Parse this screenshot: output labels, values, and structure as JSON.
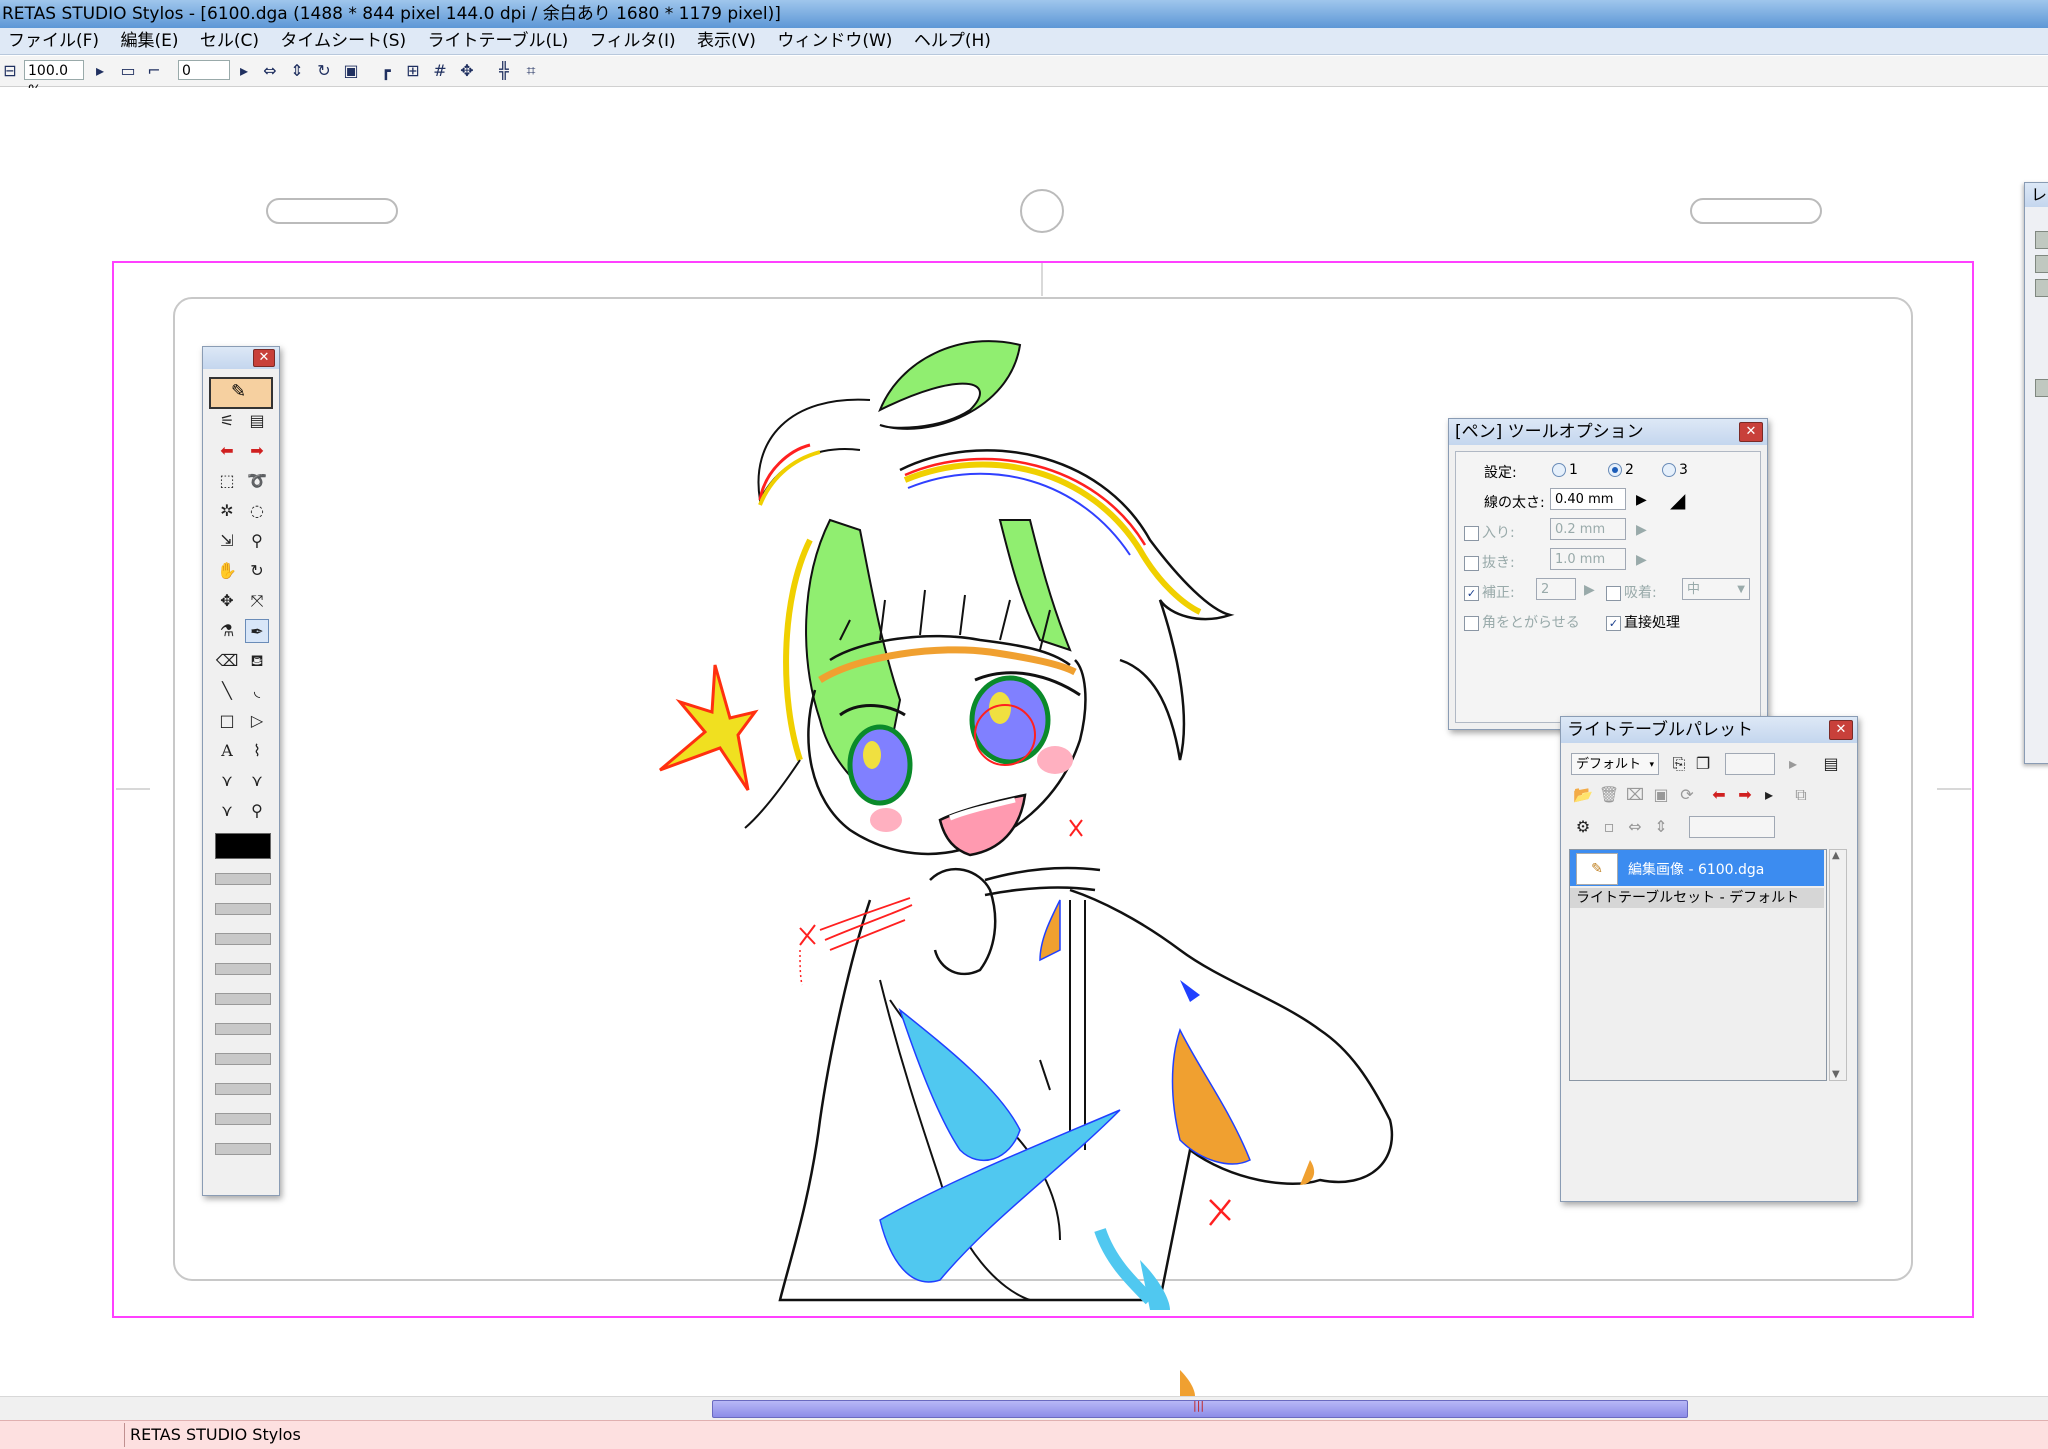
{
  "window": {
    "title": "RETAS STUDIO Stylos - [6100.dga (1488 * 844 pixel 144.0 dpi / 余白あり 1680 * 1179 pixel)]"
  },
  "menu": {
    "items": [
      "ファイル(F)",
      "編集(E)",
      "セル(C)",
      "タイムシート(S)",
      "ライトテーブル(L)",
      "フィルタ(I)",
      "表示(V)",
      "ウィンドウ(W)",
      "ヘルプ(H)"
    ]
  },
  "toolbar": {
    "zoom": "100.0 %",
    "frame": "0"
  },
  "pen_options": {
    "title": "[ペン] ツールオプション",
    "setting_label": "設定:",
    "presets": [
      "1",
      "2",
      "3"
    ],
    "selected_preset": "2",
    "width_label": "線の太さ:",
    "width_value": "0.40 mm",
    "in_label": "入り:",
    "in_value": "0.2 mm",
    "out_label": "抜き:",
    "out_value": "1.0 mm",
    "correction_label": "補正:",
    "correction_value": "2",
    "snap_label": "吸着:",
    "snap_value": "中",
    "sharp_corners_label": "角をとがらせる",
    "direct_label": "直接処理"
  },
  "lighttable": {
    "title": "ライトテーブルパレット",
    "dropdown": "デフォルト",
    "items": [
      "編集画像 - 6100.dga",
      "ライトテーブルセット - デフォルト"
    ]
  },
  "status": {
    "text": "RETAS STUDIO Stylos"
  },
  "colors": {
    "accent_magenta": "#ff40ff",
    "title_blue": "#5d97d6",
    "close_red": "#c8403a"
  },
  "icons": [
    "close-icon",
    "pen-icon",
    "brush-icon",
    "arrow-left-icon",
    "arrow-right-icon",
    "selection-icon",
    "lasso-icon",
    "zoom-icon",
    "hand-icon",
    "rotate-icon",
    "move-icon",
    "eyedropper-icon",
    "eraser-icon",
    "fill-icon",
    "line-icon",
    "curve-icon",
    "rectangle-icon",
    "polygon-icon",
    "text-icon"
  ]
}
